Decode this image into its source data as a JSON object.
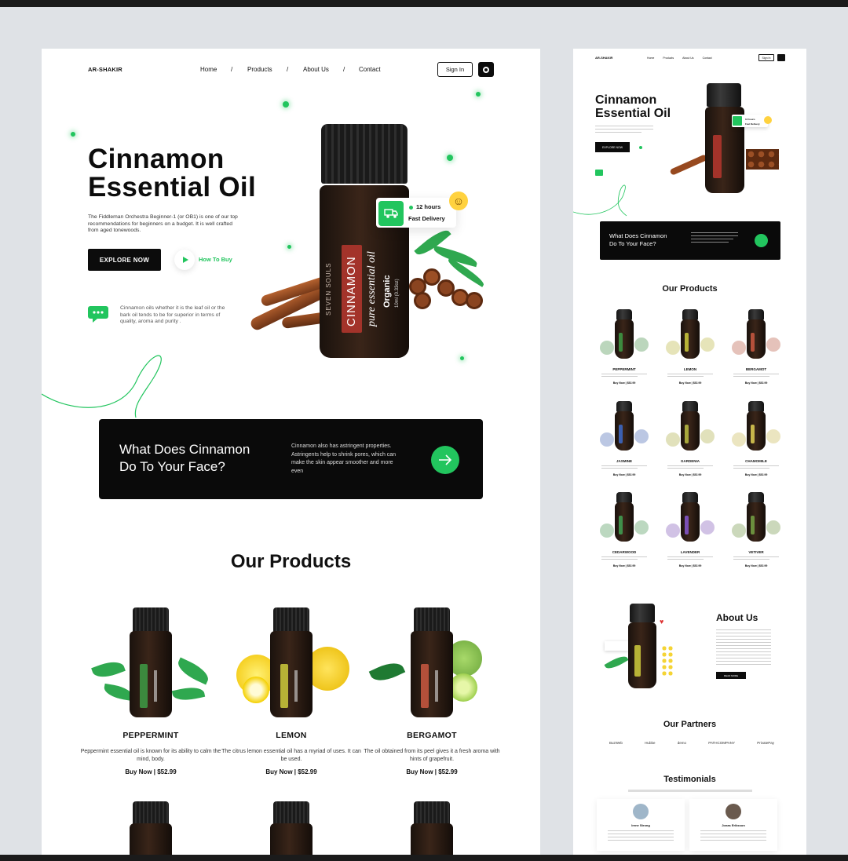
{
  "brand": "AR-SHAKIR",
  "nav": {
    "home": "Home",
    "products": "Products",
    "about": "About Us",
    "contact": "Contact",
    "sep": "/"
  },
  "signin": "Sign In",
  "hero": {
    "title_line1": "Cinnamon",
    "title_line2": "Essential Oil",
    "description": "The Fiddleman Orchestra Beginner-1 (or OB1) is one of our top recommendations for beginners on a budget. It is well crafted from aged tonewoods.",
    "explore": "EXPLORE NOW",
    "how_to_buy": "How To Buy",
    "note": "Cinnamon oils whether it is the leaf oil or the bark oil tends to be for superior in terms of quality, aroma and purity .",
    "delivery_time": "12 hours",
    "delivery_label": "Fast Delivery",
    "bottle": {
      "brand": "SEVEN SOULS",
      "name": "CINNAMON",
      "sub": "pure essential oil",
      "organic": "Organic",
      "volume": "10ml (0.33oz)"
    }
  },
  "faq": {
    "question_line1": "What Does Cinnamon",
    "question_line2": "Do To Your Face?",
    "answer": "Cinnamon also has astringent properties. Astringents help to shrink pores, which can make the skin appear smoother and more even"
  },
  "products_title": "Our Products",
  "products": [
    {
      "name": "PEPPERMINT",
      "desc": "Peppermint essential oil is known for its ability to calm the mind, body.",
      "buy": "Buy Now",
      "price": "$52.99",
      "label_color": "#3c8a3e"
    },
    {
      "name": "LEMON",
      "desc": "The citrus lemon essential oil has a myriad of uses. It can be used.",
      "buy": "Buy Now",
      "price": "$52.99",
      "label_color": "#b7b236"
    },
    {
      "name": "BERGAMOT",
      "desc": "The oil obtained from its peel gives it a fresh aroma with hints of grapefruit.",
      "buy": "Buy Now",
      "price": "$52.99",
      "label_color": "#b4503a"
    }
  ],
  "mini": {
    "products": [
      {
        "name": "PEPPERMINT",
        "label_color": "#3c8a3e"
      },
      {
        "name": "LEMON",
        "label_color": "#b7b236"
      },
      {
        "name": "BERGAMOT",
        "label_color": "#b4503a"
      },
      {
        "name": "JASMINE",
        "label_color": "#3b5fb0"
      },
      {
        "name": "GARDENIA",
        "label_color": "#a8a83c"
      },
      {
        "name": "CHAMOMILE",
        "label_color": "#c6b54a"
      },
      {
        "name": "CEDARWOOD",
        "label_color": "#3f8f4a"
      },
      {
        "name": "LAVENDER",
        "label_color": "#7a4fb5"
      },
      {
        "name": "VETIVER",
        "label_color": "#6b8f3d"
      }
    ],
    "buy_line": "Buy Now  |  $52.99",
    "about_title": "About Us",
    "read_more": "READ MORE",
    "partners_title": "Our Partners",
    "partners": [
      "BuzWeb",
      "Hubbe",
      "demo",
      "PATHCOMPANY",
      "PrivatePay"
    ],
    "testimonials_title": "Testimonials",
    "testimonials": [
      {
        "name": "Irene Strong"
      },
      {
        "name": "Jonas Eriksson"
      }
    ]
  },
  "colors": {
    "accent": "#22c55e",
    "dark": "#0c0c0c",
    "bg": "#dfe2e6"
  }
}
